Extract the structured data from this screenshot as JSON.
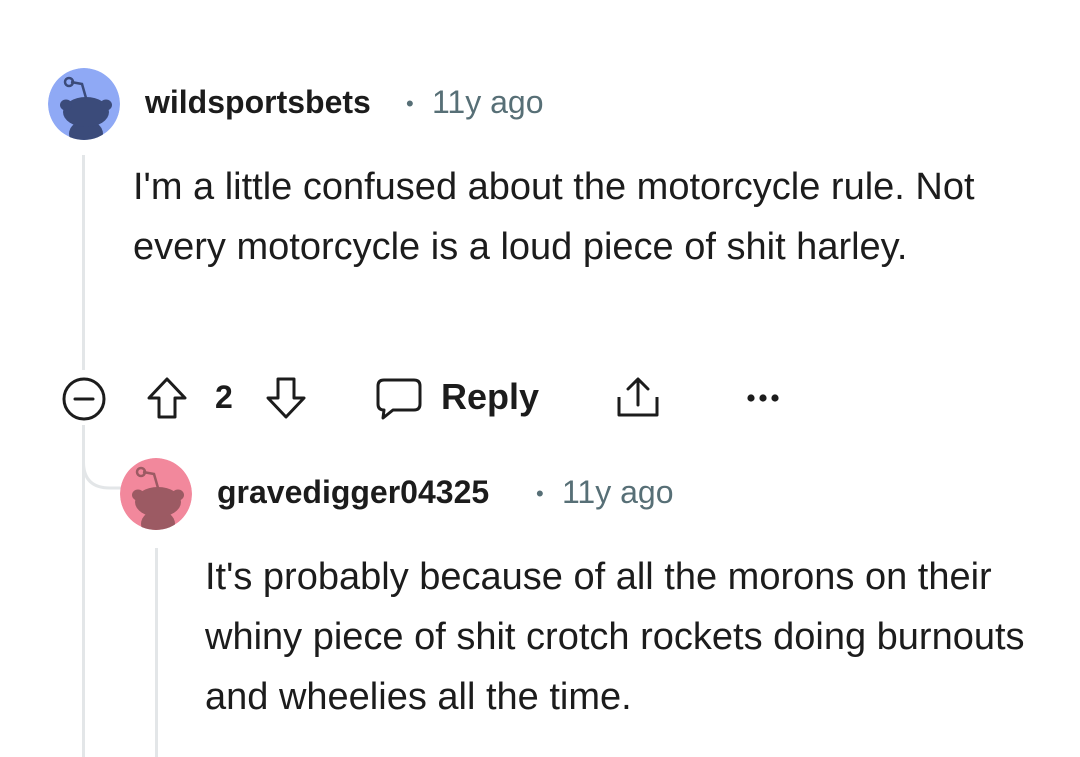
{
  "comments": [
    {
      "username": "wildsportsbets",
      "separator": "•",
      "time": "11y ago",
      "avatar_color": "#8fa9f5",
      "body": "I'm a little confused about the motorcycle rule. Not every motorcycle is a loud piece of shit harley."
    },
    {
      "username": "gravedigger04325",
      "separator": "•",
      "time": "11y ago",
      "avatar_color": "#f2889c",
      "body": "It's probably because of all the morons on their whiny piece of shit crotch rockets doing burnouts and wheelies all the time."
    }
  ],
  "actions": {
    "score": "2",
    "reply_label": "Reply",
    "collapse_icon": "collapse-icon",
    "upvote_icon": "upvote-icon",
    "downvote_icon": "downvote-icon",
    "reply_icon": "speech-bubble-icon",
    "share_icon": "share-icon",
    "more_icon": "more-options-icon"
  }
}
